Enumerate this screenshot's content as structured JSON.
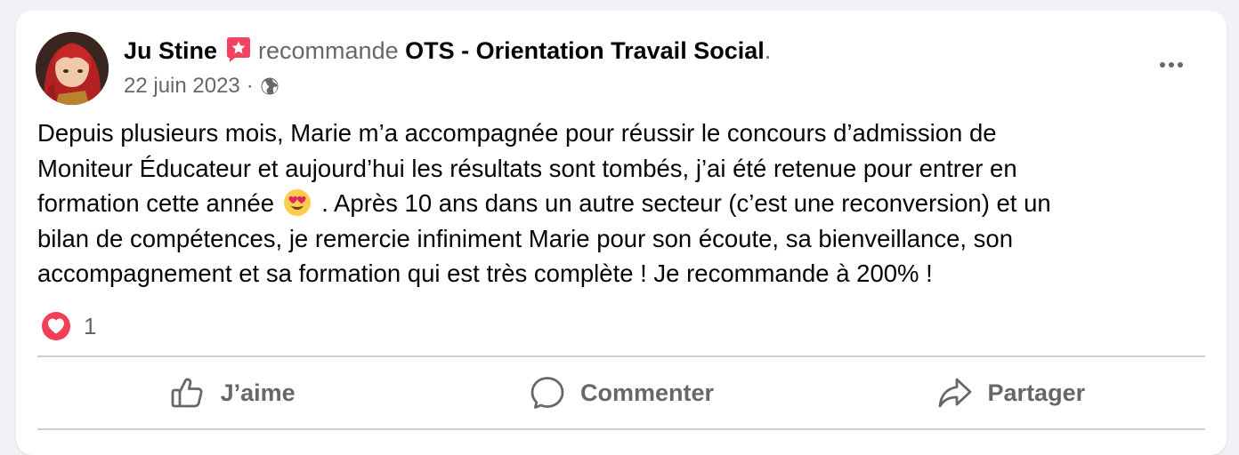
{
  "post": {
    "author": "Ju Stine",
    "verb": "recommande",
    "page_name": "OTS - Orientation Travail Social",
    "period": ".",
    "date": "22 juin 2023",
    "separator": "·",
    "audience_icon": "globe-icon",
    "recommend_icon": "recommend-star-icon",
    "text_lines": [
      "Depuis plusieurs mois, Marie m’a accompagnée pour réussir le concours d’admission de",
      "Moniteur Éducateur et aujourd’hui les résultats sont tombés, j’ai été retenue pour entrer en",
      "formation cette année",
      ". Après 10 ans dans un autre secteur (c’est une reconversion) et un",
      "bilan de compétences, je remercie infiniment Marie pour son écoute, sa bienveillance, son",
      "accompagnement et sa formation qui est très complète ! Je recommande à 200% !"
    ],
    "inline_emoji": "heart-eyes-emoji",
    "reaction_icon": "love-reaction-icon",
    "reaction_count": "1"
  },
  "actions": {
    "like_label": "J’aime",
    "comment_label": "Commenter",
    "share_label": "Partager"
  },
  "colors": {
    "card_bg": "#ffffff",
    "page_bg": "#f0f2f5",
    "text_primary": "#050505",
    "text_secondary": "#65676b",
    "recommend_red": "#f3425f",
    "divider": "#ced0d4"
  }
}
